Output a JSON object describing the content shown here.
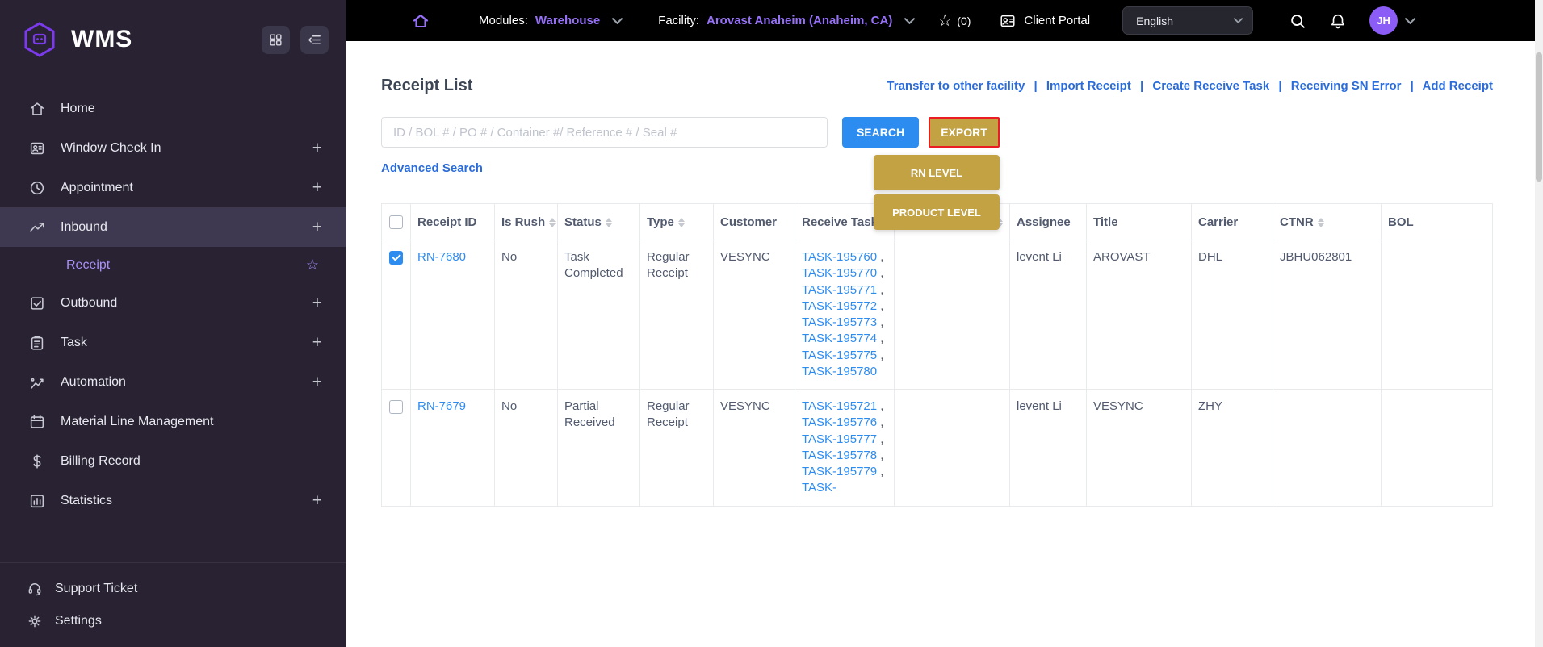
{
  "colors": {
    "accent_purple": "#8b5cf6",
    "sidebar_bg": "#282233",
    "topbar_bg": "#000000",
    "link_blue": "#2b6cd9",
    "table_link_blue": "#2d8cf0",
    "search_button_blue": "#2d8cf0",
    "export_gold": "#c2a243",
    "export_highlight_red": "#ea1c24"
  },
  "brand": {
    "logo_text": "WMS"
  },
  "topbar": {
    "modules_label": "Modules:",
    "modules_value": "Warehouse",
    "facility_label": "Facility:",
    "facility_value": "Arovast Anaheim  (Anaheim, CA)",
    "favorites_star": "☆",
    "favorites_count": "(0)",
    "client_portal": "Client Portal",
    "language": "English",
    "avatar_initials": "JH"
  },
  "sidebar": {
    "items": [
      {
        "label": "Home"
      },
      {
        "label": "Window Check In",
        "plus": "+"
      },
      {
        "label": "Appointment",
        "plus": "+"
      },
      {
        "label": "Inbound",
        "plus": "+"
      },
      {
        "label": "Receipt",
        "star": "☆"
      },
      {
        "label": "Outbound",
        "plus": "+"
      },
      {
        "label": "Task",
        "plus": "+"
      },
      {
        "label": "Automation",
        "plus": "+"
      },
      {
        "label": "Material Line Management"
      },
      {
        "label": "Billing Record"
      },
      {
        "label": "Statistics",
        "plus": "+"
      }
    ],
    "footer": [
      {
        "label": "Support Ticket"
      },
      {
        "label": "Settings"
      }
    ]
  },
  "page": {
    "title": "Receipt List",
    "actions": [
      {
        "label": "Transfer to other facility"
      },
      {
        "label": "Import Receipt"
      },
      {
        "label": "Create Receive Task"
      },
      {
        "label": "Receiving SN Error"
      },
      {
        "label": "Add Receipt"
      }
    ],
    "action_separator": "|",
    "search_placeholder": "ID / BOL # / PO # / Container #/ Reference # / Seal #",
    "search_button": "SEARCH",
    "export_button": "EXPORT",
    "export_menu": [
      {
        "label": "RN LEVEL"
      },
      {
        "label": "PRODUCT LEVEL"
      }
    ],
    "advanced_search": "Advanced Search"
  },
  "table": {
    "columns": [
      {
        "label": "Receipt ID"
      },
      {
        "label": "Is Rush"
      },
      {
        "label": "Status"
      },
      {
        "label": "Type"
      },
      {
        "label": "Customer"
      },
      {
        "label": "Receive Task"
      },
      {
        "label": ""
      },
      {
        "label": "Assignee"
      },
      {
        "label": "Title"
      },
      {
        "label": "Carrier"
      },
      {
        "label": "CTNR"
      },
      {
        "label": "BOL"
      }
    ],
    "rows": [
      {
        "checked": true,
        "receipt_id": "RN-7680",
        "is_rush": "No",
        "status": "Task Completed",
        "type": "Regular Receipt",
        "customer": "VESYNC",
        "receive_tasks": [
          "TASK-195760",
          "TASK-195770",
          "TASK-195771",
          "TASK-195772",
          "TASK-195773",
          "TASK-195774",
          "TASK-195775",
          "TASK-195780"
        ],
        "extra": "",
        "assignee": "levent Li",
        "title": "AROVAST",
        "carrier": "DHL",
        "ctnr": "JBHU062801",
        "bol": ""
      },
      {
        "checked": false,
        "receipt_id": "RN-7679",
        "is_rush": "No",
        "status": "Partial Received",
        "type": "Regular Receipt",
        "customer": "VESYNC",
        "receive_tasks": [
          "TASK-195721",
          "TASK-195776",
          "TASK-195777",
          "TASK-195778",
          "TASK-195779",
          "TASK-"
        ],
        "extra": "",
        "assignee": "levent Li",
        "title": "VESYNC",
        "carrier": "ZHY",
        "ctnr": "",
        "bol": ""
      }
    ]
  }
}
